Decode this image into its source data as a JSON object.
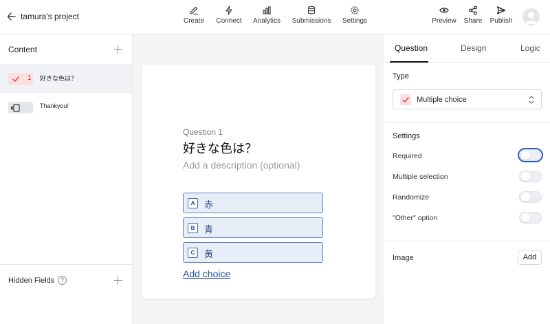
{
  "header": {
    "project_title": "tamura's project",
    "nav": {
      "create": "Create",
      "connect": "Connect",
      "analytics": "Analytics",
      "submissions": "Submissions",
      "settings": "Settings"
    },
    "actions": {
      "preview": "Preview",
      "share": "Share",
      "publish": "Publish"
    }
  },
  "sidebar": {
    "heading": "Content",
    "items": [
      {
        "number": "1",
        "label": "好きな色は？",
        "icon": "check-icon"
      },
      {
        "label": "Thankyou!",
        "icon": "ending-screen-icon"
      }
    ],
    "hidden_fields_label": "Hidden Fields",
    "help_glyph": "?"
  },
  "question": {
    "number_label": "Question 1",
    "title": "好きな色は？",
    "description_placeholder": "Add a description (optional)",
    "choices": [
      {
        "key": "A",
        "label": "赤"
      },
      {
        "key": "B",
        "label": "青"
      },
      {
        "key": "C",
        "label": "黄"
      }
    ],
    "add_choice_label": "Add choice"
  },
  "panel": {
    "tabs": {
      "question": "Question",
      "design": "Design",
      "logic": "Logic"
    },
    "active_tab": "Question",
    "type_heading": "Type",
    "type_value": "Multiple choice",
    "settings_heading": "Settings",
    "settings": [
      {
        "label": "Required",
        "on": false,
        "focused": true
      },
      {
        "label": "Multiple selection",
        "on": false
      },
      {
        "label": "Randomize",
        "on": false
      },
      {
        "label": "\"Other\" option",
        "on": false
      }
    ],
    "image_heading": "Image",
    "image_add_label": "Add"
  },
  "colors": {
    "accent_red": "#e0475a",
    "choice_blue": "#2b4c8a",
    "focus_blue": "#2563c9"
  }
}
